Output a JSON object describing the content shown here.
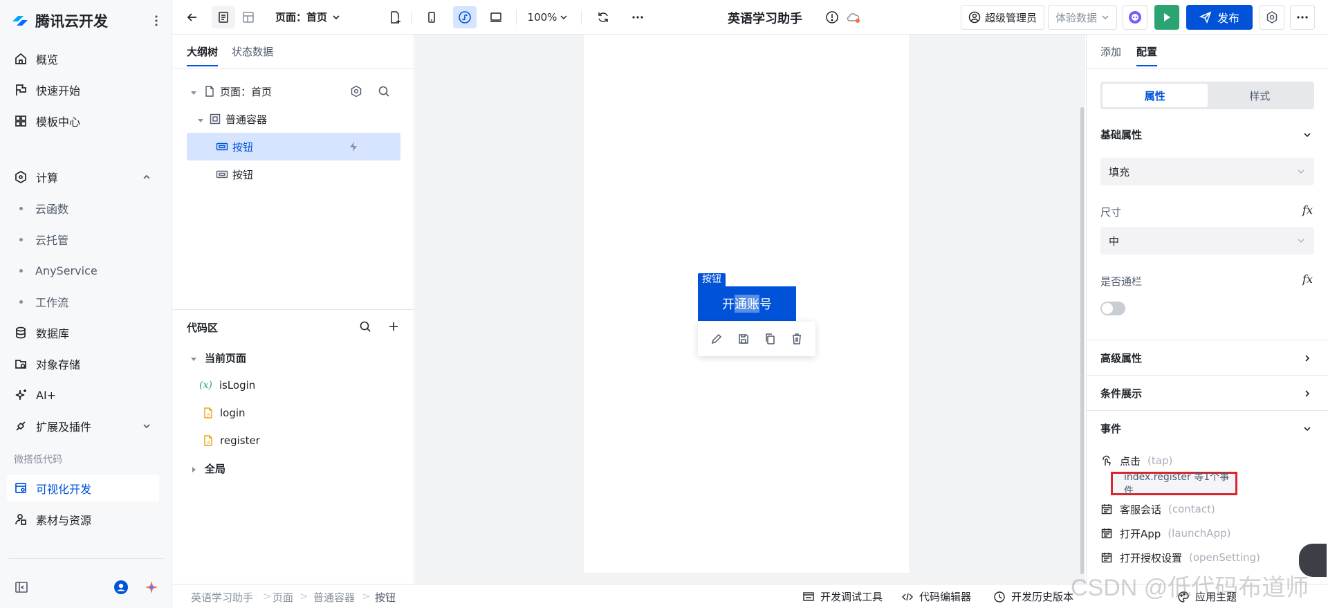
{
  "sidebar": {
    "brand": "腾讯云开发",
    "items": [
      {
        "label": "概览",
        "icon": "home-icon"
      },
      {
        "label": "快速开始",
        "icon": "flag-icon"
      },
      {
        "label": "模板中心",
        "icon": "grid-icon"
      },
      {
        "label": "计算",
        "icon": "compute-icon"
      },
      {
        "label": "数据库",
        "icon": "database-icon"
      },
      {
        "label": "对象存储",
        "icon": "storage-icon"
      },
      {
        "label": "AI+",
        "icon": "sparkle-icon"
      },
      {
        "label": "扩展及插件",
        "icon": "plugin-icon"
      },
      {
        "label": "可视化开发",
        "icon": "visual-dev-icon"
      },
      {
        "label": "素材与资源",
        "icon": "resource-icon"
      }
    ],
    "compute_children": [
      "云函数",
      "云托管",
      "AnyService",
      "工作流"
    ],
    "group_label": "微搭低代码"
  },
  "topbar": {
    "page_select": "页面：首页",
    "zoom": "100%",
    "app_title": "英语学习助手",
    "role_button": "超级管理员",
    "data_button": "体验数据",
    "publish_button": "发布"
  },
  "left_panel": {
    "tabs": [
      "大纲树",
      "状态数据"
    ],
    "tree": [
      {
        "label": "页面：首页"
      },
      {
        "label": "普通容器"
      },
      {
        "label": "按钮"
      },
      {
        "label": "按钮"
      }
    ],
    "code_area": {
      "title": "代码区",
      "current_page": "当前页面",
      "items": [
        "isLogin",
        "login",
        "register"
      ],
      "global": "全局"
    }
  },
  "canvas": {
    "selected_tag": "按钮",
    "button_text_a": "开",
    "button_text_b": "通账",
    "button_text_c": "号"
  },
  "right_panel": {
    "tabs": [
      "添加",
      "配置"
    ],
    "segments": [
      "属性",
      "样式"
    ],
    "basic_props": "基础属性",
    "fill_value": "填充",
    "size_label": "尺寸",
    "size_value": "中",
    "block_label": "是否通栏",
    "advanced": "高级属性",
    "conditional": "条件展示",
    "events": "事件",
    "fx": "fx",
    "event_items": [
      {
        "label": "点击",
        "sub": "(tap)"
      },
      {
        "label": "客服会话",
        "sub": "(contact)"
      },
      {
        "label": "打开App",
        "sub": "(launchApp)"
      },
      {
        "label": "打开授权设置",
        "sub": "(openSetting)"
      }
    ],
    "event_badge": "index.register 等1个事件"
  },
  "statusbar": {
    "breadcrumb": [
      "英语学习助手",
      "页面",
      "普通容器",
      "按钮"
    ],
    "tools": [
      "开发调试工具",
      "代码编辑器",
      "开发历史版本",
      "应用主题"
    ]
  },
  "watermark": "CSDN @低代码布道师",
  "colors": {
    "accent": "#0052d9",
    "run": "#2ba471",
    "highlight_border": "#d9262e"
  }
}
